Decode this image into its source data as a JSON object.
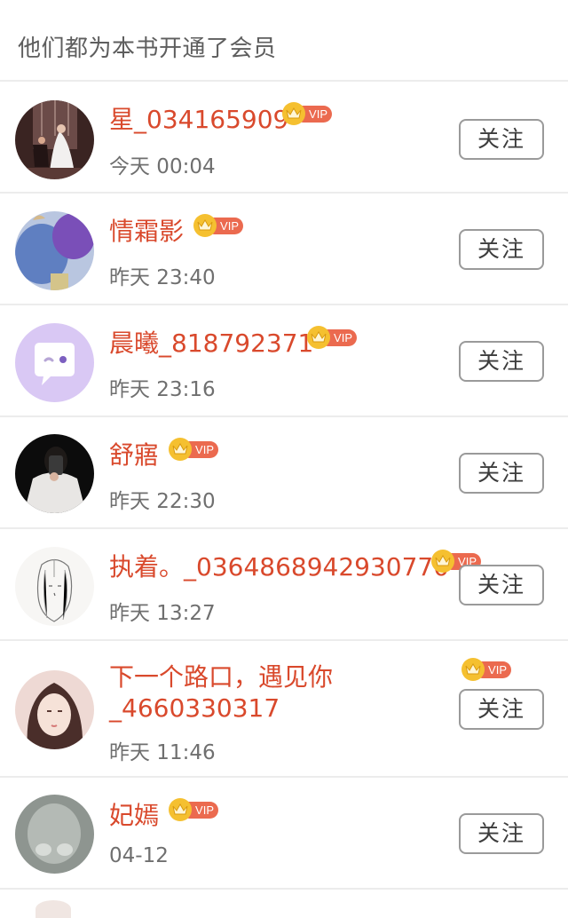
{
  "header": {
    "title": "他们都为本书开通了会员"
  },
  "vip_label": "VIP",
  "follow_label": "关注",
  "rows": [
    {
      "name": "星_034165909",
      "time": "今天 00:04",
      "avatar": "wedding-photo-avatar"
    },
    {
      "name": "情霜影",
      "time": "昨天 23:40",
      "avatar": "balloons-avatar"
    },
    {
      "name": "晨曦_818792371",
      "time": "昨天 23:16",
      "avatar": "default-chat-bubble-avatar"
    },
    {
      "name": "舒寤",
      "time": "昨天 22:30",
      "avatar": "mirror-selfie-avatar"
    },
    {
      "name": "执着。_0364868942930770",
      "time": "昨天 13:27",
      "avatar": "sketch-girl-avatar"
    },
    {
      "name_line1": "下一个路口，遇见你",
      "name_line2": "_4660330317",
      "time": "昨天 11:46",
      "avatar": "illustrated-girl-avatar"
    },
    {
      "name": "妃嫣",
      "time": "04-12",
      "avatar": "cat-paw-avatar"
    }
  ],
  "colors": {
    "name": "#d9492c",
    "vip_pill": "#eb6a4f",
    "crown": "#f5c030",
    "divider": "#ececec"
  }
}
